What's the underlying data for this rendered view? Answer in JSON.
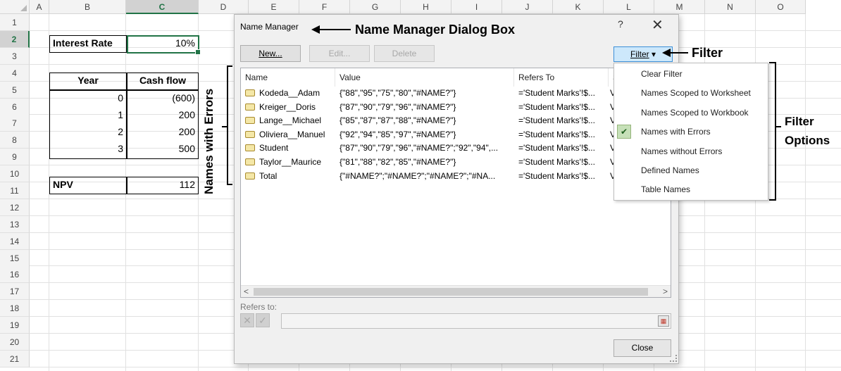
{
  "sheet": {
    "columns": [
      "A",
      "B",
      "C",
      "D",
      "E",
      "F",
      "G",
      "H",
      "I",
      "J",
      "K",
      "L",
      "M",
      "N",
      "O"
    ],
    "rows": [
      "1",
      "2",
      "3",
      "4",
      "5",
      "6",
      "7",
      "8",
      "9",
      "10",
      "11",
      "12",
      "13",
      "14",
      "15",
      "16",
      "17",
      "18",
      "19",
      "20",
      "21"
    ],
    "selected_column": "C",
    "selected_row": "2",
    "interest_rate_label": "Interest Rate",
    "interest_rate_value": "10%",
    "year_header": "Year",
    "cashflow_header": "Cash flow",
    "cashflows": [
      {
        "year": "0",
        "cash": "(600)"
      },
      {
        "year": "1",
        "cash": "200"
      },
      {
        "year": "2",
        "cash": "200"
      },
      {
        "year": "3",
        "cash": "500"
      }
    ],
    "npv_label": "NPV",
    "npv_value": "112"
  },
  "dialog": {
    "title": "Name Manager",
    "help": "?",
    "close_icon": "✕",
    "new_label": "New...",
    "edit_label": "Edit...",
    "delete_label": "Delete",
    "filter_label": "Filter",
    "columns": [
      "Name",
      "Value",
      "Refers To",
      "S"
    ],
    "names": [
      {
        "name": "Kodeda__Adam",
        "value": "{\"88\",\"95\",\"75\",\"80\",\"#NAME?\"}",
        "refers": "='Student Marks'!$...",
        "scope": "V"
      },
      {
        "name": "Kreiger__Doris",
        "value": "{\"87\",\"90\",\"79\",\"96\",\"#NAME?\"}",
        "refers": "='Student Marks'!$...",
        "scope": "V"
      },
      {
        "name": "Lange__Michael",
        "value": "{\"85\",\"87\",\"87\",\"88\",\"#NAME?\"}",
        "refers": "='Student Marks'!$...",
        "scope": "V"
      },
      {
        "name": "Oliviera__Manuel",
        "value": "{\"92\",\"94\",\"85\",\"97\",\"#NAME?\"}",
        "refers": "='Student Marks'!$...",
        "scope": "V"
      },
      {
        "name": "Student",
        "value": "{\"87\",\"90\",\"79\",\"96\",\"#NAME?\";\"92\",\"94\",...",
        "refers": "='Student Marks'!$...",
        "scope": "V"
      },
      {
        "name": "Taylor__Maurice",
        "value": "{\"81\",\"88\",\"82\",\"85\",\"#NAME?\"}",
        "refers": "='Student Marks'!$...",
        "scope": "V"
      },
      {
        "name": "Total",
        "value": "{\"#NAME?\";\"#NAME?\";\"#NAME?\";\"#NA...",
        "refers": "='Student Marks'!$...",
        "scope": "V"
      }
    ],
    "refers_to_label": "Refers to:",
    "close_button_label": "Close"
  },
  "filter_menu": {
    "items": [
      {
        "label": "Clear Filter",
        "checked": false
      },
      {
        "label": "Names Scoped to Worksheet",
        "checked": false
      },
      {
        "label": "Names Scoped to Workbook",
        "checked": false
      },
      {
        "label": "Names with Errors",
        "checked": true
      },
      {
        "label": "Names without Errors",
        "checked": false
      },
      {
        "label": "Defined Names",
        "checked": false
      },
      {
        "label": "Table Names",
        "checked": false
      }
    ]
  },
  "annotations": {
    "dialog_box": "Name Manager Dialog Box",
    "filter": "Filter",
    "filter_options_line1": "Filter",
    "filter_options_line2": "Options",
    "names_with_errors": "Names with Errors"
  },
  "colors": {
    "excel_green": "#217346",
    "filter_button": "#cde8fb",
    "check_bg": "#c6e0b8"
  }
}
